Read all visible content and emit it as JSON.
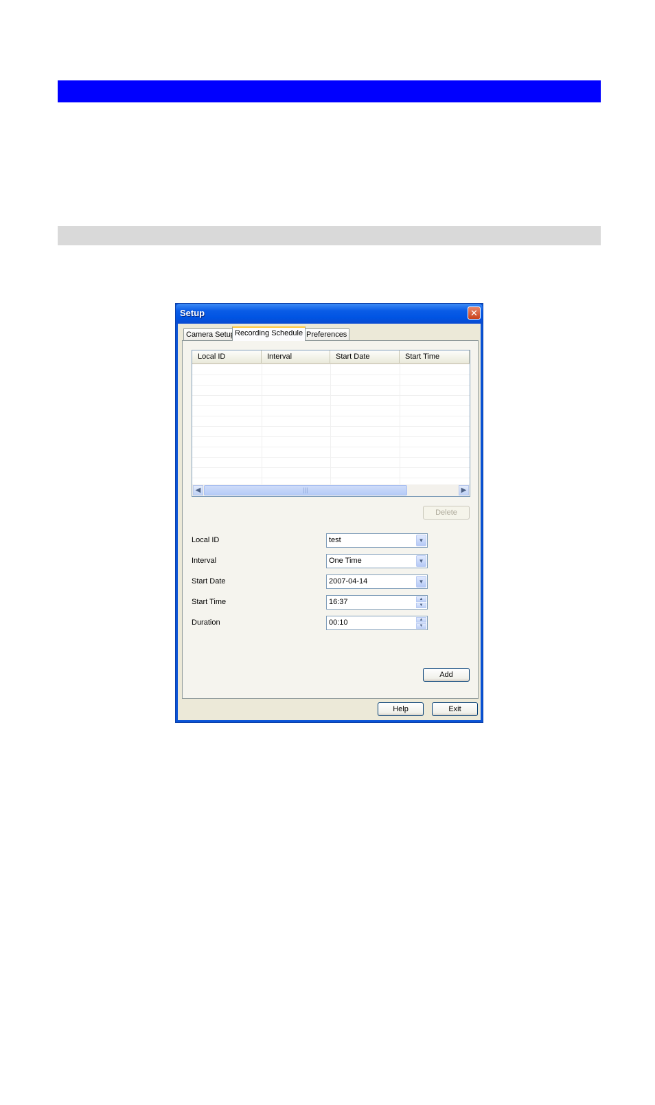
{
  "window": {
    "title": "Setup"
  },
  "tabs": [
    {
      "label": "Camera Setup",
      "active": false
    },
    {
      "label": "Recording Schedule",
      "active": true
    },
    {
      "label": "Preferences",
      "active": false
    }
  ],
  "schedule_table": {
    "columns": [
      "Local ID",
      "Interval",
      "Start Date",
      "Start Time"
    ],
    "rows": []
  },
  "buttons": {
    "delete": "Delete",
    "add": "Add",
    "help": "Help",
    "exit": "Exit"
  },
  "form": {
    "local_id": {
      "label": "Local ID",
      "value": "test"
    },
    "interval": {
      "label": "Interval",
      "value": "One Time"
    },
    "start_date": {
      "label": "Start Date",
      "value": "2007-04-14"
    },
    "start_time": {
      "label": "Start Time",
      "value": "16:37"
    },
    "duration": {
      "label": "Duration",
      "value": "00:10"
    }
  },
  "icons": {
    "close": "close-icon",
    "scroll_left": "chevron-left-icon",
    "scroll_right": "chevron-right-icon",
    "dropdown": "chevron-down-icon",
    "spin_up": "chevron-up-icon",
    "spin_down": "chevron-down-icon"
  },
  "colors": {
    "header_bar": "#0000ff",
    "section_bar": "#d9d9d9",
    "titlebar": "#0054e3"
  }
}
